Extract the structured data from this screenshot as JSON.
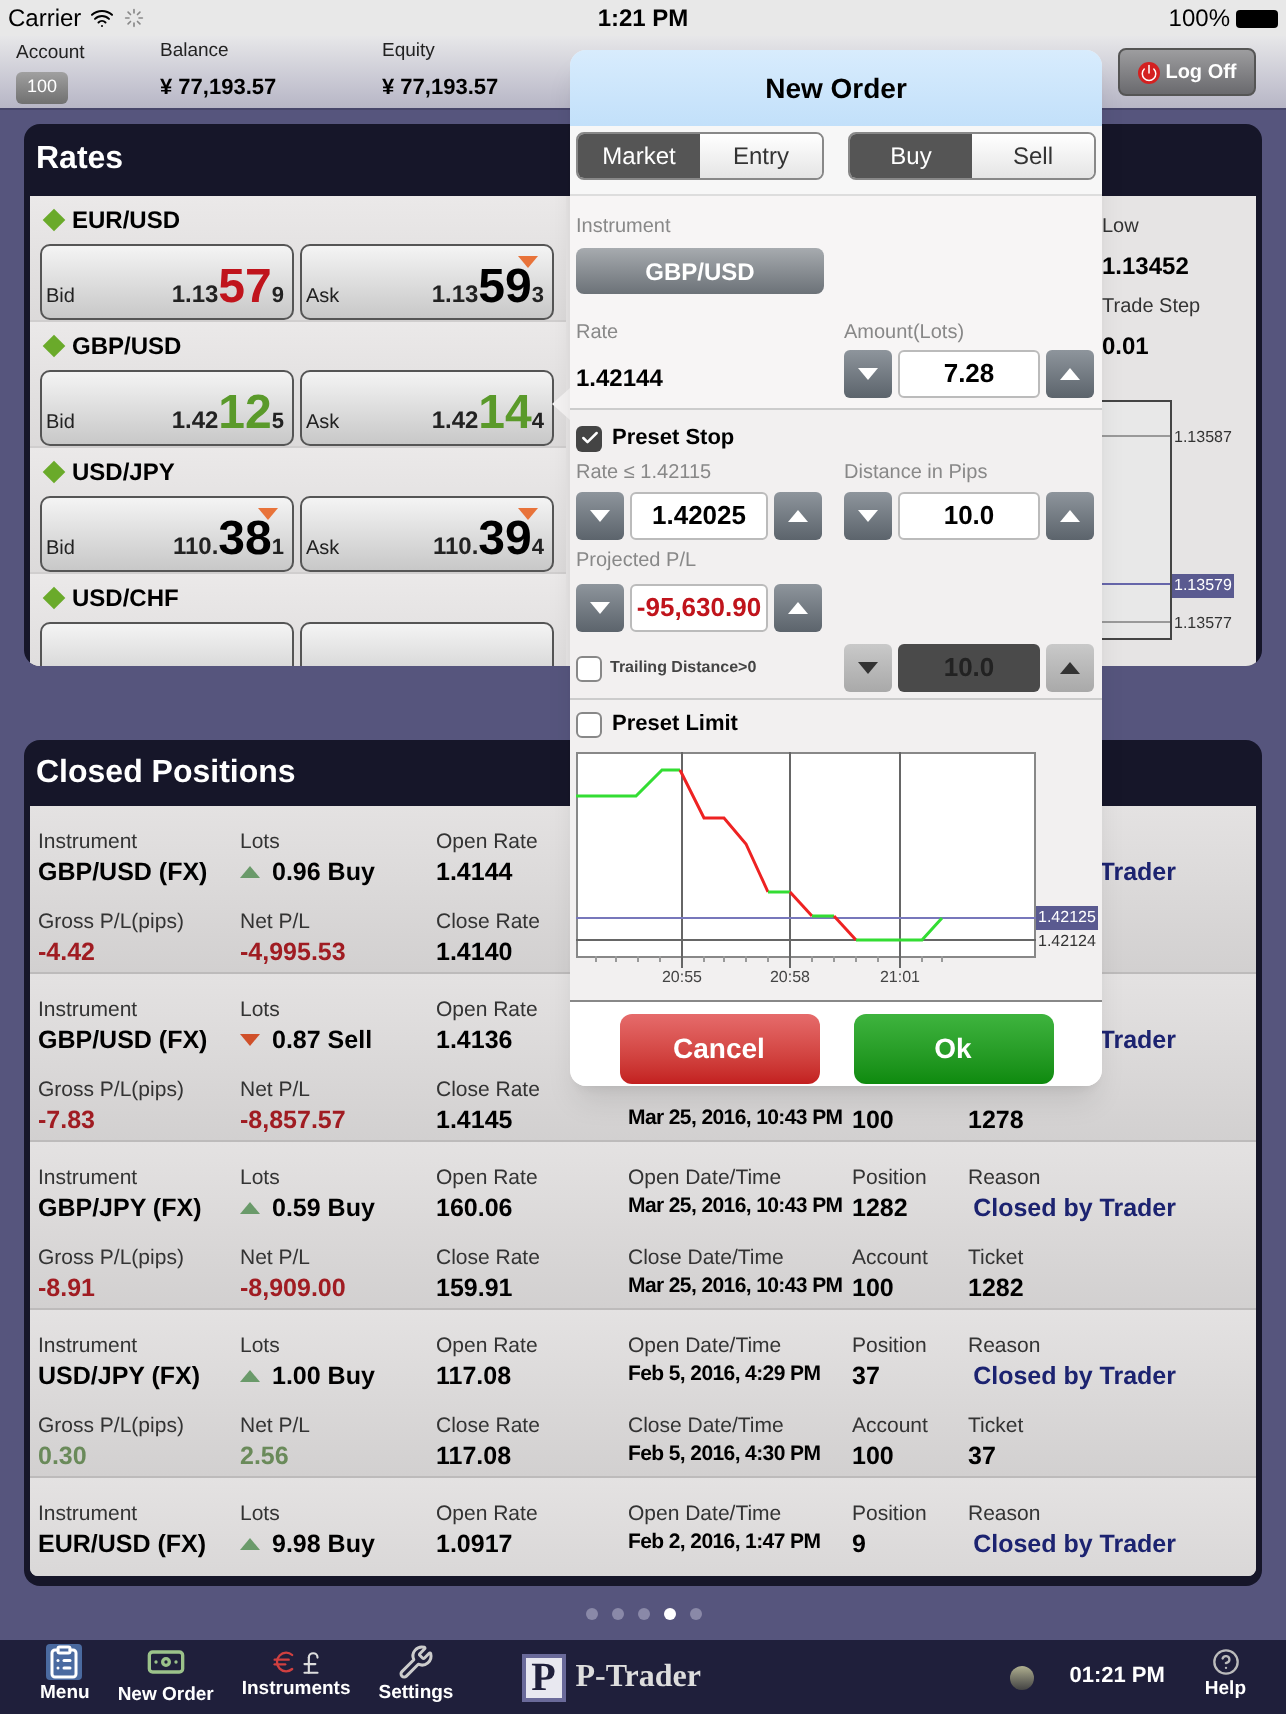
{
  "status_bar": {
    "carrier": "Carrier",
    "time": "1:21 PM",
    "battery": "100%"
  },
  "account_bar": {
    "fields": [
      {
        "label": "Account",
        "value": "100",
        "kind": "button"
      },
      {
        "label": "Balance",
        "value": "¥ 77,193.57",
        "kind": "text"
      },
      {
        "label": "Equity",
        "value": "¥ 77,193.57",
        "kind": "text"
      }
    ],
    "logoff": "Log Off"
  },
  "rates": {
    "title": "Rates",
    "pairs": [
      {
        "symbol": "EUR/USD",
        "quotes": [
          {
            "side": "Bid",
            "base": "1.13",
            "big": "57",
            "pip": "9",
            "color": "#c0141c",
            "marker": false
          },
          {
            "side": "Ask",
            "base": "1.13",
            "big": "59",
            "pip": "3",
            "color": "#000000",
            "marker": true
          }
        ]
      },
      {
        "symbol": "GBP/USD",
        "quotes": [
          {
            "side": "Bid",
            "base": "1.42",
            "big": "12",
            "pip": "5",
            "color": "#5a9a2a",
            "marker": false
          },
          {
            "side": "Ask",
            "base": "1.42",
            "big": "14",
            "pip": "4",
            "color": "#5a9a2a",
            "marker": false
          }
        ]
      },
      {
        "symbol": "USD/JPY",
        "quotes": [
          {
            "side": "Bid",
            "base": "110.",
            "big": "38",
            "pip": "1",
            "color": "#000000",
            "marker": true
          },
          {
            "side": "Ask",
            "base": "110.",
            "big": "39",
            "pip": "4",
            "color": "#000000",
            "marker": true
          }
        ]
      },
      {
        "symbol": "USD/CHF"
      }
    ],
    "details": [
      {
        "label": "Low",
        "value": "1.13452"
      },
      {
        "label": "Trade Step",
        "value": "0.01"
      }
    ],
    "mini_chart_labels": [
      {
        "text": "1.13587",
        "highlight": false
      },
      {
        "text": "1.13579",
        "highlight": true
      },
      {
        "text": "1.13577",
        "highlight": false
      }
    ]
  },
  "new_order": {
    "title": "New Order",
    "order_type": [
      {
        "label": "Market",
        "selected": true
      },
      {
        "label": "Entry",
        "selected": false
      }
    ],
    "direction": [
      {
        "label": "Buy",
        "selected": true
      },
      {
        "label": "Sell",
        "selected": false
      }
    ],
    "instrument_label": "Instrument",
    "instrument": "GBP/USD",
    "rate_label": "Rate",
    "rate": "1.42144",
    "amount_label": "Amount(Lots)",
    "amount": "7.28",
    "preset_stop": {
      "label": "Preset Stop",
      "checked": true,
      "rate_label": "Rate ≤ 1.42115",
      "rate": "1.42025",
      "distance_label": "Distance in Pips",
      "distance": "10.0",
      "pl_label": "Projected P/L",
      "pl": "-95,630.90"
    },
    "trailing": {
      "label": "Trailing Distance>0",
      "checked": false,
      "value": "10.0"
    },
    "preset_limit": {
      "label": "Preset Limit",
      "checked": false
    },
    "chart": {
      "time_labels": [
        "20:55",
        "20:58",
        "21:01"
      ],
      "price_labels": [
        {
          "text": "1.42125",
          "highlight": true
        },
        {
          "text": "1.42124",
          "highlight": false
        }
      ]
    },
    "buttons": [
      {
        "label": "Cancel",
        "kind": "cancel"
      },
      {
        "label": "Ok",
        "kind": "ok"
      }
    ]
  },
  "closed_positions": {
    "title": "Closed Positions",
    "rows": [
      {
        "instrument": {
          "label": "Instrument",
          "value": "GBP/USD (FX)"
        },
        "lots": {
          "label": "Lots",
          "value": "0.96 Buy",
          "rising": true
        },
        "open_rate": {
          "label": "Open Rate",
          "value": "1.4144"
        },
        "reason": {
          "value": "Trader",
          "color": "#1c2370"
        },
        "gross": {
          "label": "Gross P/L(pips)",
          "value": "-4.42",
          "color": "#a01c22"
        },
        "net": {
          "label": "Net P/L",
          "value": "-4,995.53",
          "color": "#a01c22"
        },
        "close_rate": {
          "label": "Close Rate",
          "value": "1.4140"
        }
      },
      {
        "instrument": {
          "label": "Instrument",
          "value": "GBP/USD (FX)"
        },
        "lots": {
          "label": "Lots",
          "value": "0.87 Sell",
          "rising": false
        },
        "open_rate": {
          "label": "Open Rate",
          "value": "1.4136"
        },
        "reason": {
          "value": "Trader",
          "color": "#1c2370"
        },
        "gross": {
          "label": "Gross P/L(pips)",
          "value": "-7.83",
          "color": "#a01c22"
        },
        "net": {
          "label": "Net P/L",
          "value": "-8,857.57",
          "color": "#a01c22"
        },
        "close_rate": {
          "label": "Close Rate",
          "value": "1.4145"
        },
        "close_time": {
          "value": "Mar 25, 2016, 10:43 PM"
        },
        "account": {
          "value": "100"
        },
        "ticket": {
          "value": "1278"
        }
      },
      {
        "instrument": {
          "label": "Instrument",
          "value": "GBP/JPY (FX)"
        },
        "lots": {
          "label": "Lots",
          "value": "0.59 Buy",
          "rising": true
        },
        "open_rate": {
          "label": "Open Rate",
          "value": "160.06"
        },
        "open_time": {
          "label": "Open Date/Time",
          "value": "Mar 25, 2016, 10:43 PM"
        },
        "position": {
          "label": "Position",
          "value": "1282"
        },
        "reason": {
          "label": "Reason",
          "value": "Closed by Trader",
          "color": "#1c2370"
        },
        "gross": {
          "label": "Gross P/L(pips)",
          "value": "-8.91",
          "color": "#a01c22"
        },
        "net": {
          "label": "Net P/L",
          "value": "-8,909.00",
          "color": "#a01c22"
        },
        "close_rate": {
          "label": "Close Rate",
          "value": "159.91"
        },
        "close_time": {
          "label": "Close Date/Time",
          "value": "Mar 25, 2016, 10:43 PM"
        },
        "account": {
          "label": "Account",
          "value": "100"
        },
        "ticket": {
          "label": "Ticket",
          "value": "1282"
        }
      },
      {
        "instrument": {
          "label": "Instrument",
          "value": "USD/JPY (FX)"
        },
        "lots": {
          "label": "Lots",
          "value": "1.00 Buy",
          "rising": true
        },
        "open_rate": {
          "label": "Open Rate",
          "value": "117.08"
        },
        "open_time": {
          "label": "Open Date/Time",
          "value": "Feb 5, 2016, 4:29 PM"
        },
        "position": {
          "label": "Position",
          "value": "37"
        },
        "reason": {
          "label": "Reason",
          "value": "Closed by Trader",
          "color": "#1c2370"
        },
        "gross": {
          "label": "Gross P/L(pips)",
          "value": "0.30",
          "color": "#6a8a5a"
        },
        "net": {
          "label": "Net P/L",
          "value": "2.56",
          "color": "#6a8a5a"
        },
        "close_rate": {
          "label": "Close Rate",
          "value": "117.08"
        },
        "close_time": {
          "label": "Close Date/Time",
          "value": "Feb 5, 2016, 4:30 PM"
        },
        "account": {
          "label": "Account",
          "value": "100"
        },
        "ticket": {
          "label": "Ticket",
          "value": "37"
        }
      },
      {
        "instrument": {
          "label": "Instrument",
          "value": "EUR/USD (FX)"
        },
        "lots": {
          "label": "Lots",
          "value": "9.98 Buy",
          "rising": true
        },
        "open_rate": {
          "label": "Open Rate",
          "value": "1.0917"
        },
        "open_time": {
          "label": "Open Date/Time",
          "value": "Feb 2, 2016, 1:47 PM"
        },
        "position": {
          "label": "Position",
          "value": "9"
        },
        "reason": {
          "label": "Reason",
          "value": "Closed by Trader",
          "color": "#1c2370"
        }
      }
    ]
  },
  "pages": [
    {
      "selected": false
    },
    {
      "selected": false
    },
    {
      "selected": false
    },
    {
      "selected": true
    },
    {
      "selected": false
    }
  ],
  "tab_bar": {
    "tabs": [
      {
        "label": "Menu",
        "kind": "menu"
      },
      {
        "label": "New Order",
        "kind": "order"
      },
      {
        "label": "Instruments",
        "kind": "instruments"
      },
      {
        "label": "Settings",
        "kind": "settings"
      }
    ],
    "logo_mark": "P",
    "logo": "P-Trader",
    "time": "01:21 PM",
    "help": "Help"
  }
}
